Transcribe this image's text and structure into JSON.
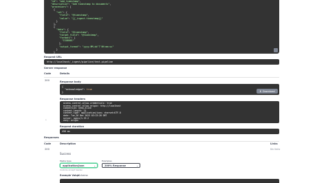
{
  "request_code": {
    "lines": [
      "  \"id\": \"add_timestamp\",",
      "  \"description\": \"Add timestamp to documents\",",
      "  \"processors\": [",
      "    {",
      "      \"set\": {",
      "        \"field\": \"@timestamp\",",
      "        \"value\": \"{{_ingest.timestamp}}\"",
      "      }",
      "    },",
      "    {",
      "      \"date\": {",
      "        \"field\": \"@timestamp\",",
      "        \"target_field\": \"@timestamp\",",
      "        \"formats\": [",
      "          \"ISO8601\"",
      "        ],",
      "        \"output_format\": \"yyyy-MM-dd'T'HH:mm:ss\"",
      "      }",
      "    }",
      "  ]",
      "}"
    ]
  },
  "request_url": {
    "label": "Request URL",
    "value": "http://localhost/_ingest/pipeline/test-pipeline"
  },
  "server_response": {
    "heading": "Server response",
    "col_code": "Code",
    "col_details": "Details",
    "code": "200",
    "body_label": "Response body",
    "body_lines": [
      "{",
      "  \"acknowledged\": true",
      "}"
    ],
    "download_label": "Download",
    "headers_label": "Response headers",
    "headers_lines": [
      " access-control-allow-credentials: true",
      " access-control-allow-origin: http://localhost",
      " connection: keep-alive",
      " content-length: 21",
      " content-type: application/json; charset=UTF-8",
      " date: Tue,26 Dec 2023 03:13:28 GMT",
      " server: nginx/1.19.2",
      " vary: origin"
    ],
    "duration_label": "Request duration",
    "duration_value": "456 ms"
  },
  "responses": {
    "heading": "Responses",
    "col_code": "Code",
    "col_description": "Description",
    "col_links": "Links",
    "code": "200",
    "description": "Success",
    "links": "No links",
    "media_type_label": "Media type",
    "media_type_value": "application/json",
    "controls_accept": "Controls Accept header.",
    "examples_label": "Examples",
    "examples_value": "200% Response",
    "example_value_label": "Example Value",
    "schema_label": "Schema"
  },
  "colors": {
    "code_bg": "#333333",
    "accent_green": "#49cc90",
    "button_grey": "#7d8492"
  }
}
